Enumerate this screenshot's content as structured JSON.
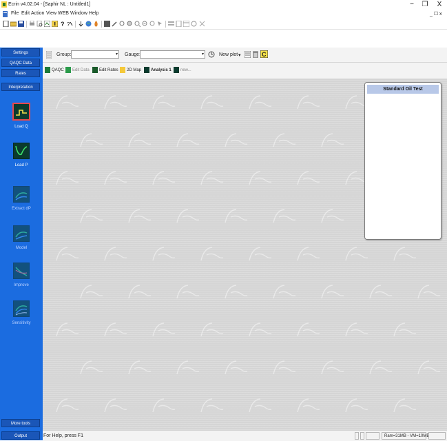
{
  "window": {
    "title": "Ecrin v4.02.04 - [Saphir NL : Untitled1]",
    "minimize": "−",
    "restore": "❐",
    "close": "X"
  },
  "menu": {
    "items": [
      "File",
      "Edit",
      "Action",
      "View",
      "WEB",
      "Window",
      "Help"
    ],
    "mdi_controls": "_ ☐ x"
  },
  "sidebar": {
    "top_buttons": [
      "Settings",
      "QAQC Data",
      "Rates",
      "Interpretation"
    ],
    "tools": [
      {
        "label": "Load Q",
        "icon": "load-q-icon",
        "enabled": true,
        "selected": true
      },
      {
        "label": "Load P",
        "icon": "load-p-icon",
        "enabled": true,
        "selected": false
      },
      {
        "label": "Extract dP",
        "icon": "extract-dp-icon",
        "enabled": false,
        "selected": false
      },
      {
        "label": "Model",
        "icon": "model-icon",
        "enabled": false,
        "selected": false
      },
      {
        "label": "Improve",
        "icon": "improve-icon",
        "enabled": false,
        "selected": false
      },
      {
        "label": "Sensitivity",
        "icon": "sensitivity-icon",
        "enabled": false,
        "selected": false
      }
    ],
    "bottom_buttons": [
      "More tools",
      "Output"
    ]
  },
  "groupbar": {
    "group_label": "Group:",
    "group_value": "",
    "gauge_label": "Gauge:",
    "gauge_value": "",
    "new_plot_label": "New plot"
  },
  "tabs": [
    {
      "label": "QAQC",
      "dim": false,
      "active": false
    },
    {
      "label": "Edit Data",
      "dim": true,
      "active": false
    },
    {
      "label": "Edit Rates",
      "dim": false,
      "active": false
    },
    {
      "label": "2D Map",
      "dim": false,
      "active": false
    },
    {
      "label": "Analysis 1",
      "dim": false,
      "active": true
    },
    {
      "label": "new...",
      "dim": true,
      "active": false
    }
  ],
  "panel": {
    "title": "Standard Oil Test"
  },
  "status": {
    "help_text": "For Help, press F1",
    "memory": "Ram=31MB - VM=10MB"
  },
  "colors": {
    "sidebar_bg": "#1b6ce0",
    "sidebar_button": "#1a56b8",
    "canvas_bg": "#d5d5d5",
    "panel_header": "#b8c8e8",
    "selected_tool_border": "#e8484b"
  }
}
